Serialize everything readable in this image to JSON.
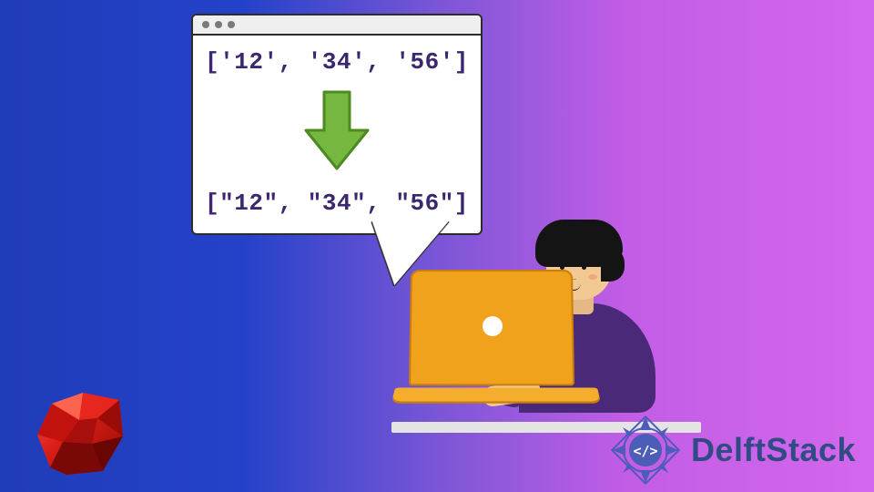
{
  "code_window": {
    "input_line": "['12', '34', '56']",
    "output_line": "[\"12\", \"34\", \"56\"]"
  },
  "icons": {
    "arrow": "arrow-down-icon",
    "ruby": "ruby-language-logo",
    "delft_badge": "delftstack-badge-icon"
  },
  "brand": {
    "name": "DelftStack"
  },
  "colors": {
    "code_text": "#3b2770",
    "arrow_fill": "#76b740",
    "laptop": "#f0a21d",
    "shirt": "#4a2a78",
    "ruby": "#c2120e",
    "delft_text": "#314b85",
    "delft_badge": "#4c5db8"
  }
}
